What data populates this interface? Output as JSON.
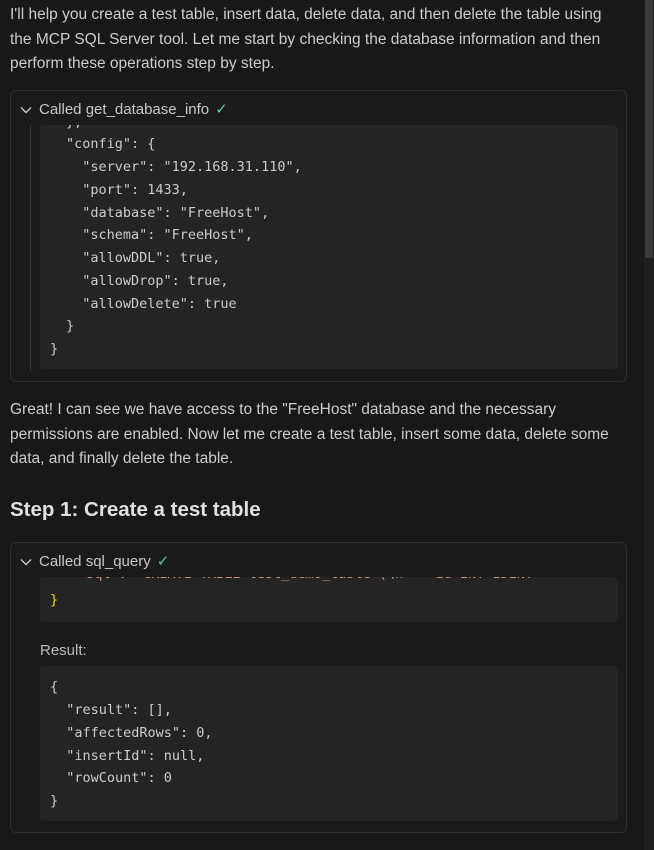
{
  "intro": "I'll help you create a test table, insert data, delete data, and then delete the table using the MCP SQL Server tool. Let me start by checking the database information and then perform these operations step by step.",
  "tool1": {
    "label": "Called get_database_info",
    "check": "✓",
    "clipped_line": "},",
    "lines": [
      "\"config\": {",
      "  \"server\": \"192.168.31.110\",",
      "  \"port\": 1433,",
      "  \"database\": \"FreeHost\",",
      "  \"schema\": \"FreeHost\",",
      "  \"allowDDL\": true,",
      "  \"allowDrop\": true,",
      "  \"allowDelete\": true",
      "}",
      "}"
    ]
  },
  "para2": "Great! I can see we have access to the \"FreeHost\" database and the necessary permissions are enabled. Now let me create a test table, insert some data, delete some data, and finally delete the table.",
  "step1_heading": "Step 1: Create a test table",
  "tool2": {
    "label": "Called sql_query",
    "check": "✓",
    "clipped_line": "\"sql\": \"CREATE TABLE test_demo_table (\\n    id INT IDENT",
    "closing": "}",
    "result_label": "Result:",
    "result_lines": [
      "{",
      "  \"result\": [],",
      "  \"affectedRows\": 0,",
      "  \"insertId\": null,",
      "  \"rowCount\": 0",
      "}"
    ]
  }
}
